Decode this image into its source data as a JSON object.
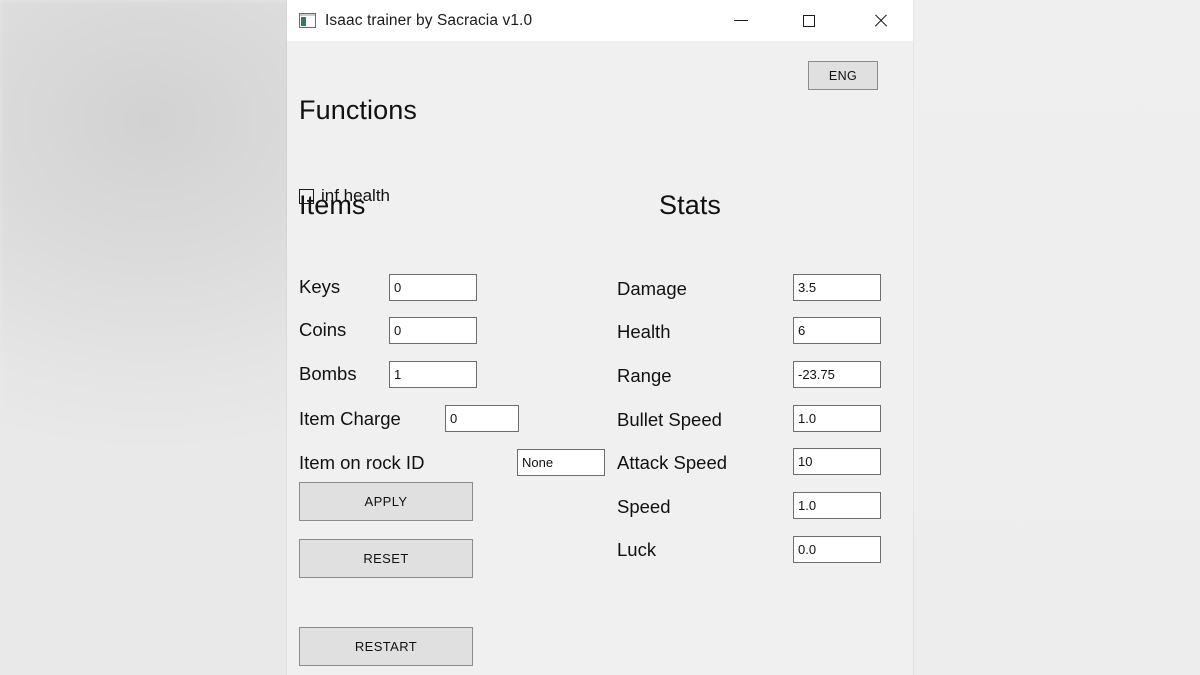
{
  "window": {
    "title": "Isaac trainer by Sacracia v1.0",
    "icon": "app-window-icon",
    "controls": {
      "minimize": "minimize-icon",
      "maximize": "maximize-icon",
      "close": "close-icon"
    }
  },
  "language_button": {
    "label": "ENG"
  },
  "functions": {
    "heading": "Functions",
    "inf_health": {
      "label": "inf health",
      "checked": false
    }
  },
  "items": {
    "heading": "Items",
    "fields": [
      {
        "label": "Keys",
        "value": "0"
      },
      {
        "label": "Coins",
        "value": "0"
      },
      {
        "label": "Bombs",
        "value": "1"
      }
    ],
    "item_charge": {
      "label": "Item Charge",
      "value": "0"
    },
    "item_on_rock": {
      "label": "Item on rock ID",
      "value": "None"
    }
  },
  "stats": {
    "heading": "Stats",
    "fields": [
      {
        "label": "Damage",
        "value": "3.5"
      },
      {
        "label": "Health",
        "value": "6"
      },
      {
        "label": "Range",
        "value": "-23.75"
      },
      {
        "label": "Bullet Speed",
        "value": "1.0"
      },
      {
        "label": "Attack Speed",
        "value": "10"
      },
      {
        "label": "Speed",
        "value": "1.0"
      },
      {
        "label": "Luck",
        "value": "0.0"
      }
    ]
  },
  "actions": {
    "apply": "APPLY",
    "reset": "RESET",
    "restart": "RESTART"
  },
  "colors": {
    "window_background": "#f0f0f0",
    "titlebar_background": "#ffffff",
    "button_face": "#e0e0e0",
    "button_border": "#8c8c8c",
    "input_border": "#6e6e6e",
    "text": "#111111",
    "icon_accent": "#2f7a6a"
  }
}
